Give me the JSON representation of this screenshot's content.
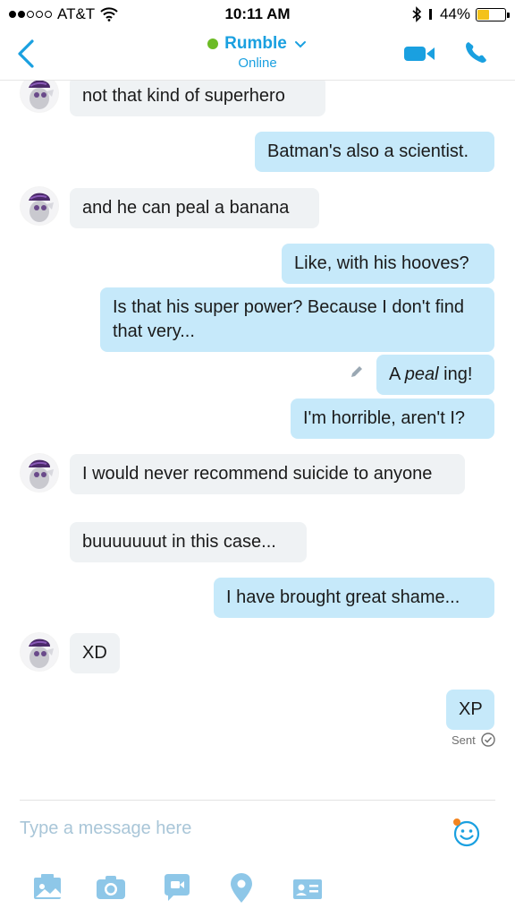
{
  "status_bar": {
    "carrier": "AT&T",
    "time": "10:11 AM",
    "battery": "44%",
    "battery_level": 0.44
  },
  "header": {
    "contact_name": "Rumble",
    "presence": "Online",
    "colors": {
      "accent": "#1aa0e0",
      "online": "#6cbb25"
    }
  },
  "messages": [
    {
      "dir": "in",
      "text": "not that kind of superhero"
    },
    {
      "dir": "out",
      "text": "Batman's also a scientist."
    },
    {
      "dir": "in",
      "text": "and he can peal a banana"
    },
    {
      "dir": "out",
      "text": "Like, with his hooves?"
    },
    {
      "dir": "out",
      "text": "Is that his super power? Because I don't find that very..."
    },
    {
      "dir": "out",
      "text_parts": [
        "A ",
        "peal",
        " ing!"
      ],
      "edited": true
    },
    {
      "dir": "out",
      "text": "I'm horrible, aren't I?"
    },
    {
      "dir": "in",
      "text": "I would never recommend suicide to anyone"
    },
    {
      "dir": "in",
      "text": "buuuuuuut in this case..."
    },
    {
      "dir": "out",
      "text": "I have brought great shame..."
    },
    {
      "dir": "in",
      "text": "XD"
    },
    {
      "dir": "out",
      "text": "XP"
    }
  ],
  "delivery_status": "Sent",
  "composer": {
    "placeholder": "Type a message here"
  },
  "toolbar": {
    "icons": [
      "gallery-icon",
      "camera-icon",
      "video-message-icon",
      "location-icon",
      "contact-card-icon"
    ]
  },
  "colors": {
    "incoming_bubble": "#eff2f4",
    "outgoing_bubble": "#c6e9fa",
    "accent": "#1aa0e0"
  }
}
